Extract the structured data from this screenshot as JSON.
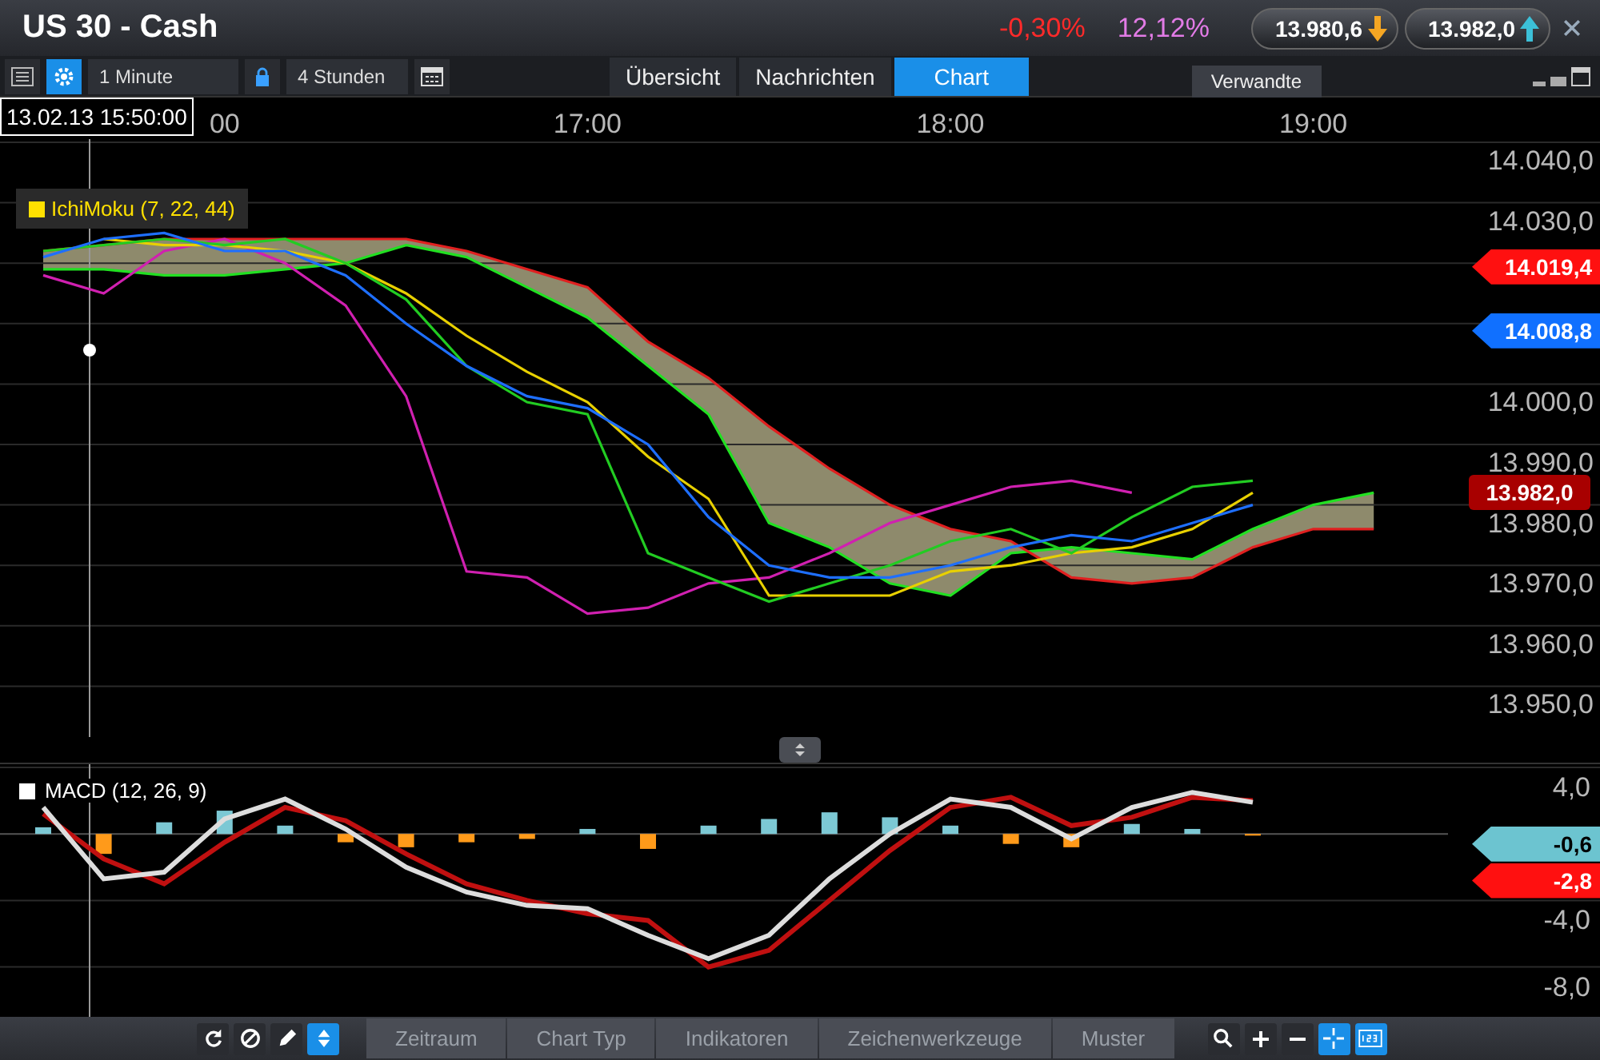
{
  "window": {
    "title": "US 30 - Cash"
  },
  "figures": [
    {
      "text": "-0,30%",
      "color": "#ff2a2a"
    },
    {
      "text": "12,12%",
      "color": "#e27be6"
    }
  ],
  "quotes": [
    {
      "price": "13.980,6",
      "rising": false
    },
    {
      "price": "13.982,0",
      "rising": true
    }
  ],
  "toolbar": {
    "interval": "1 Minute",
    "range": "4 Stunden"
  },
  "tabs": [
    {
      "label": "Übersicht",
      "selected": false
    },
    {
      "label": "Nachrichten",
      "selected": false
    },
    {
      "label": "Chart",
      "selected": true
    }
  ],
  "side_tab": "Verwandte",
  "crosshair": {
    "label": "13.02.13 15:50:00"
  },
  "main_chart": {
    "legend": {
      "label": "IchiMoku (7, 22, 44)",
      "color": "#ffe000"
    },
    "chart_data": {
      "type": "line",
      "categories": [
        null,
        null,
        null,
        "00",
        null,
        null,
        null,
        null,
        null,
        "17:00",
        null,
        null,
        null,
        null,
        null,
        "18:00",
        null,
        null,
        null,
        null,
        null,
        "19:00",
        null
      ],
      "ylim": [
        13950,
        14040
      ],
      "grid": true,
      "yticks": [
        {
          "value": 14040,
          "label": "14.040,0"
        },
        {
          "value": 14030,
          "label": "14.030,0"
        },
        {
          "value": 14020,
          "label": null
        },
        {
          "value": 14010,
          "label": null
        },
        {
          "value": 14000,
          "label": "14.000,0"
        },
        {
          "value": 13990,
          "label": "13.990,0"
        },
        {
          "value": 13980,
          "label": "13.980,0"
        },
        {
          "value": 13970,
          "label": "13.970,0"
        },
        {
          "value": 13960,
          "label": "13.960,0"
        },
        {
          "value": 13950,
          "label": "13.950,0"
        }
      ],
      "series": [
        {
          "color": "#22e022",
          "values": [
            14019,
            14019,
            14018,
            14018,
            14019,
            14020,
            14023,
            14021,
            14016,
            14011,
            14003,
            13995,
            13977,
            13973,
            13967,
            13965,
            13972,
            13973,
            13972,
            13971,
            13976,
            13980,
            13982
          ]
        },
        {
          "color": "#e02020",
          "values": [
            14022,
            14023,
            14024,
            14024,
            14024,
            14024,
            14024,
            14022,
            14019,
            14016,
            14007,
            14001,
            13993,
            13986,
            13980,
            13976,
            13974,
            13968,
            13967,
            13968,
            13973,
            13976,
            13976
          ]
        },
        {
          "color": "#d020b0",
          "values": [
            14018,
            14015,
            14022,
            14024,
            14020,
            14013,
            13998,
            13969,
            13968,
            13962,
            13963,
            13967,
            13968,
            13972,
            13977,
            13980,
            13983,
            13984,
            13982,
            null,
            null,
            null,
            null
          ]
        },
        {
          "color": "#e8d000",
          "values": [
            null,
            14024,
            14023,
            14023,
            14022,
            14020,
            14015,
            14008,
            14002,
            13997,
            13988,
            13981,
            13965,
            13965,
            13965,
            13969,
            13970,
            13972,
            13973,
            13976,
            13982,
            null,
            null
          ]
        },
        {
          "color": "#22cc22",
          "values": [
            14022,
            14023,
            14024,
            14023,
            14024,
            14020,
            14014,
            14003,
            13997,
            13995,
            13972,
            13968,
            13964,
            13967,
            13970,
            13974,
            13976,
            13972,
            13978,
            13983,
            13984,
            null,
            null
          ]
        },
        {
          "color": "#1e6fff",
          "values": [
            14021,
            14024,
            14025,
            14022,
            14022,
            14018,
            14010,
            14003,
            13998,
            13996,
            13990,
            13978,
            13970,
            13968,
            13968,
            13970,
            13973,
            13975,
            13974,
            13977,
            13980,
            null,
            null
          ]
        }
      ]
    },
    "price_tags": [
      {
        "text": "14.019,4",
        "pointed": true,
        "color": "#ff1010"
      },
      {
        "text": "14.008,8",
        "pointed": true,
        "color": "#1070ff"
      },
      {
        "text": "13.982,0",
        "pointed": false,
        "color": "#a80000"
      }
    ]
  },
  "macd_panel": {
    "legend": {
      "label": "MACD (12, 26, 9)",
      "color": "#ffffff"
    },
    "chart_data": {
      "type": "line",
      "categories": [
        null,
        null,
        null,
        null,
        null,
        null,
        null,
        null,
        null,
        null,
        null,
        null,
        null,
        null,
        null,
        null,
        null,
        null,
        null,
        null,
        null,
        null,
        null
      ],
      "ylim": [
        -8,
        4
      ],
      "grid": true,
      "yticks": [
        {
          "value": 4,
          "label": "4,0"
        },
        {
          "value": -4,
          "label": "-4,0"
        },
        {
          "value": -8,
          "label": "-8,0"
        }
      ],
      "series": [
        {
          "color": "#c01010",
          "values": [
            1.2,
            -1.5,
            -3.0,
            -0.5,
            1.6,
            0.8,
            -1.2,
            -3.0,
            -4.0,
            -4.8,
            -5.2,
            -8.0,
            -7.0,
            -4.0,
            -1.0,
            1.6,
            2.2,
            0.5,
            1.0,
            2.2,
            2.0,
            null,
            null
          ]
        },
        {
          "color": "#dddddd",
          "values": [
            1.6,
            -2.7,
            -2.3,
            0.9,
            2.1,
            0.3,
            -2.0,
            -3.5,
            -4.3,
            -4.5,
            -6.1,
            -7.5,
            -6.1,
            -2.7,
            0,
            2.1,
            1.6,
            -0.3,
            1.6,
            2.5,
            1.9,
            null,
            null
          ]
        }
      ]
    },
    "value_tags": [
      {
        "text": "-0,6",
        "pointed": true,
        "color": "#6cc4d0"
      },
      {
        "text": "-2,8",
        "pointed": true,
        "color": "#ff1010"
      }
    ]
  },
  "bottom_tabs": [
    "Zeitraum",
    "Chart Typ",
    "Indikatoren",
    "Zeichenwerkzeuge",
    "Muster"
  ]
}
